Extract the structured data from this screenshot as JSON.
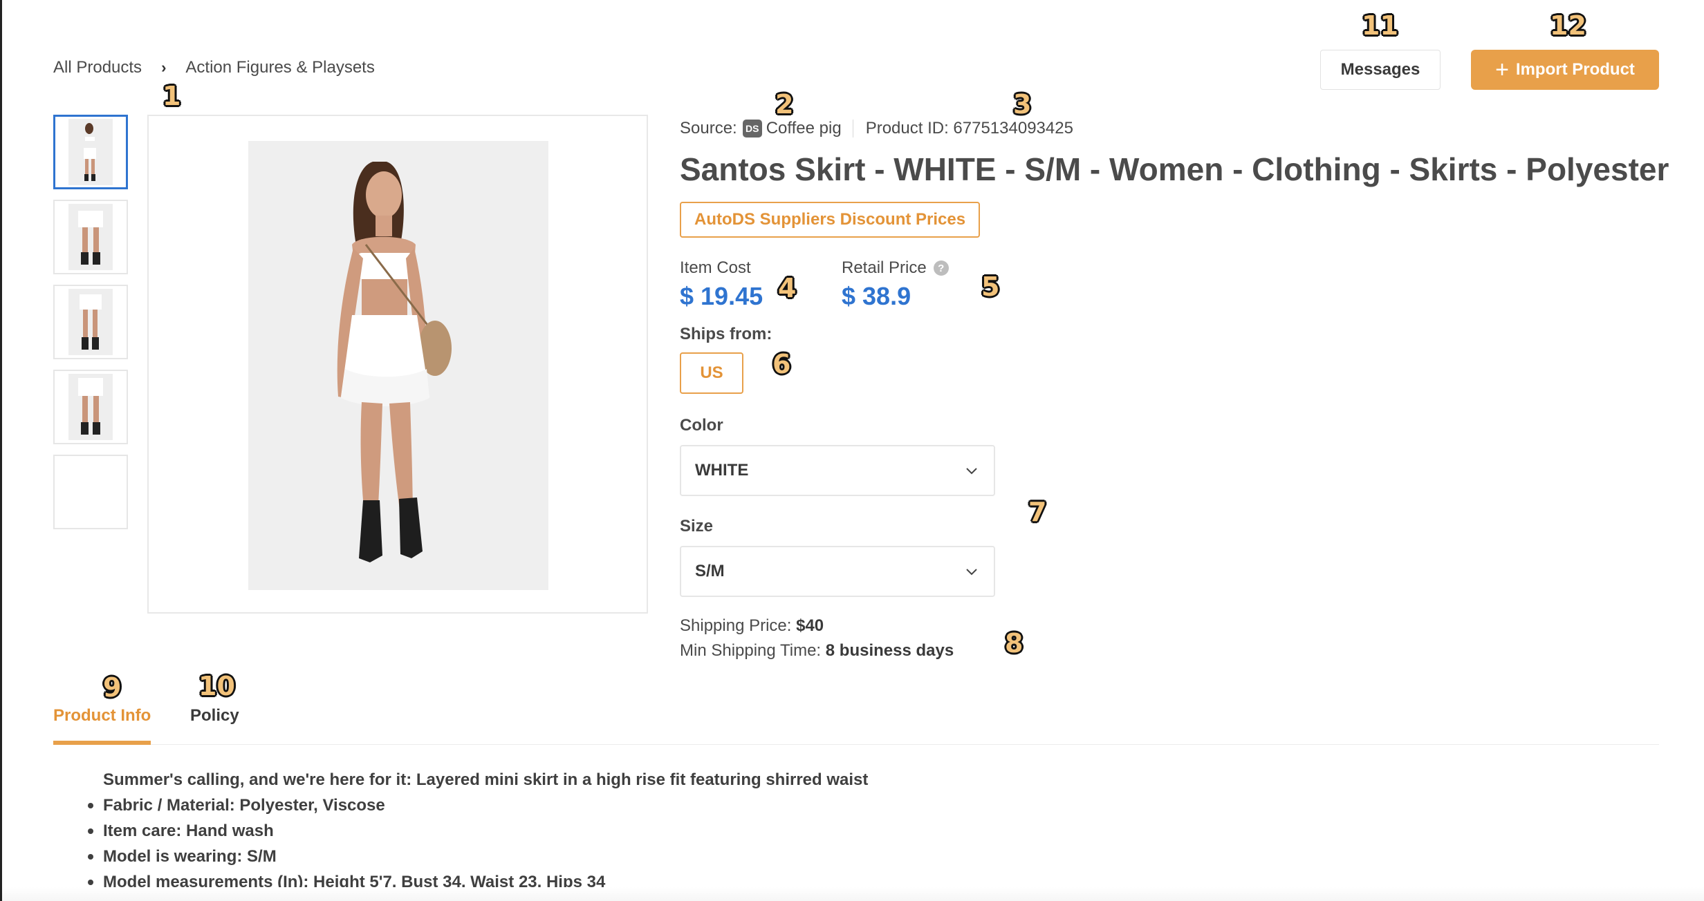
{
  "breadcrumb": {
    "items": [
      "All Products",
      "Action Figures & Playsets"
    ],
    "separator": "›"
  },
  "header": {
    "messages_label": "Messages",
    "import_label": "Import Product",
    "import_icon": "plus-icon"
  },
  "product": {
    "source_label": "Source:",
    "source_badge": "DS",
    "source_name": "Coffee pig",
    "product_id_label": "Product ID: 6775134093425",
    "title": "Santos Skirt - WHITE - S/M - Women - Clothing - Skirts - Polyester",
    "discount_tag": "AutoDS Suppliers Discount Prices",
    "item_cost_label": "Item Cost",
    "item_cost_value": "$ 19.45",
    "retail_price_label": "Retail Price",
    "retail_price_value": "$ 38.9",
    "ships_from_label": "Ships from:",
    "ships_from_option": "US",
    "color_label": "Color",
    "color_value": "WHITE",
    "size_label": "Size",
    "size_value": "S/M",
    "shipping_price_label": "Shipping Price: ",
    "shipping_price_value": "$40",
    "min_shipping_label": "Min Shipping Time: ",
    "min_shipping_value": "8 business days"
  },
  "gallery": {
    "thumbnail_count": 5,
    "active_index": 0
  },
  "tabs": {
    "product_info": "Product Info",
    "policy": "Policy"
  },
  "description": {
    "intro": "Summer's calling, and we're here for it: Layered mini skirt in a high rise fit featuring shirred waist",
    "bullets": [
      "Fabric / Material: Polyester, Viscose",
      "Item care: Hand wash",
      "Model is wearing: S/M",
      "Model measurements (In): Height 5'7, Bust 34, Waist 23, Hips 34"
    ]
  },
  "markers": [
    "1",
    "2",
    "3",
    "4",
    "5",
    "6",
    "7",
    "8",
    "9",
    "10",
    "11",
    "12"
  ],
  "colors": {
    "accent_orange": "#e8a04a",
    "price_blue": "#2f74d0",
    "active_thumb_border": "#2f74d0"
  }
}
